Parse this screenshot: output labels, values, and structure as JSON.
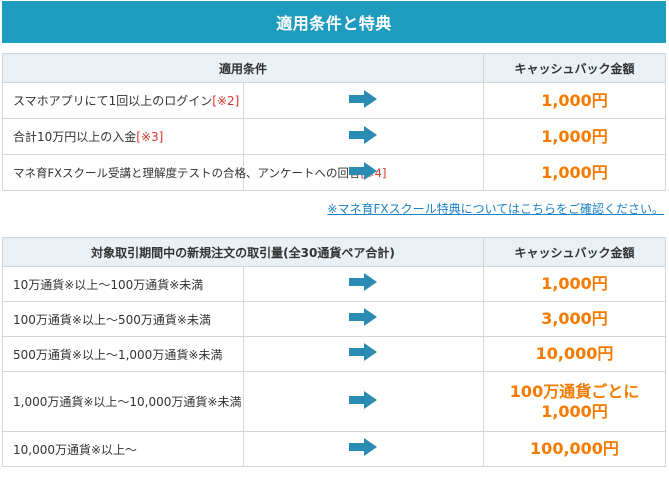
{
  "title": "適用条件と特典",
  "table1": {
    "header_condition": "適用条件",
    "header_amount": "キャッシュバック金額",
    "rows": [
      {
        "text": "スマホアプリにて1回以上のログイン",
        "ref": "[※2]",
        "amount": "1,000円"
      },
      {
        "text": "合計10万円以上の入金",
        "ref": "[※3]",
        "amount": "1,000円"
      },
      {
        "text": "マネ育FXスクール受講と理解度テストの合格、アンケートへの回答",
        "ref": "[※4]",
        "amount": "1,000円"
      }
    ]
  },
  "note_link": "※マネ育FXスクール特典についてはこちらをご確認ください。",
  "table2": {
    "header_condition": "対象取引期間中の新規注文の取引量(全30通貨ペア合計)",
    "header_amount": "キャッシュバック金額",
    "rows": [
      {
        "text": "10万通貨※以上～100万通貨※未満",
        "amount_line1": "1,000円",
        "amount_line2": ""
      },
      {
        "text": "100万通貨※以上～500万通貨※未満",
        "amount_line1": "3,000円",
        "amount_line2": ""
      },
      {
        "text": "500万通貨※以上～1,000万通貨※未満",
        "amount_line1": "10,000円",
        "amount_line2": ""
      },
      {
        "text": "1,000万通貨※以上～10,000万通貨※未満",
        "amount_line1": "100万通貨ごとに",
        "amount_line2": "1,000円"
      },
      {
        "text": "10,000万通貨※以上～",
        "amount_line1": "100,000円",
        "amount_line2": ""
      }
    ]
  },
  "colors": {
    "title_bg": "#1f9bbf",
    "header_bg": "#e9f1f6",
    "amount": "#f47b00",
    "arrow": "#2a8bb3",
    "reference": "#d9342b",
    "link": "#1c82c5"
  },
  "icons": {
    "arrow": "right-arrow-icon"
  }
}
